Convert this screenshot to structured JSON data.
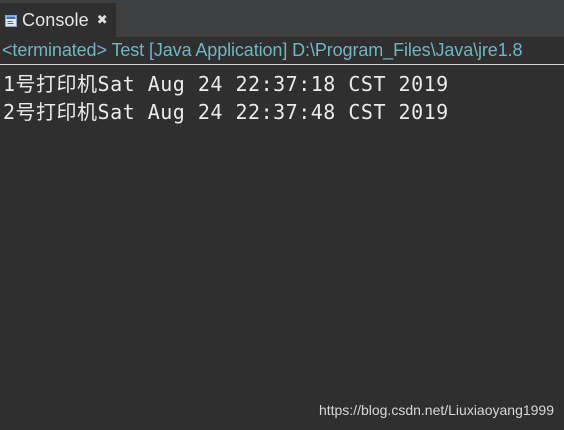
{
  "tab": {
    "icon": "console-icon",
    "label": "Console",
    "close_icon": "close-icon",
    "close_glyph": "✖"
  },
  "status": {
    "text": "<terminated> Test [Java Application] D:\\Program_Files\\Java\\jre1.8"
  },
  "output": {
    "lines": [
      "1号打印机Sat Aug 24 22:37:18 CST 2019",
      "2号打印机Sat Aug 24 22:37:48 CST 2019"
    ]
  },
  "watermark": {
    "text": "https://blog.csdn.net/Liuxiaoyang1999"
  },
  "colors": {
    "background": "#2f2f2f",
    "tabbar": "#3d3f41",
    "status_text": "#6fb6c3",
    "output_text": "#ebebeb"
  }
}
